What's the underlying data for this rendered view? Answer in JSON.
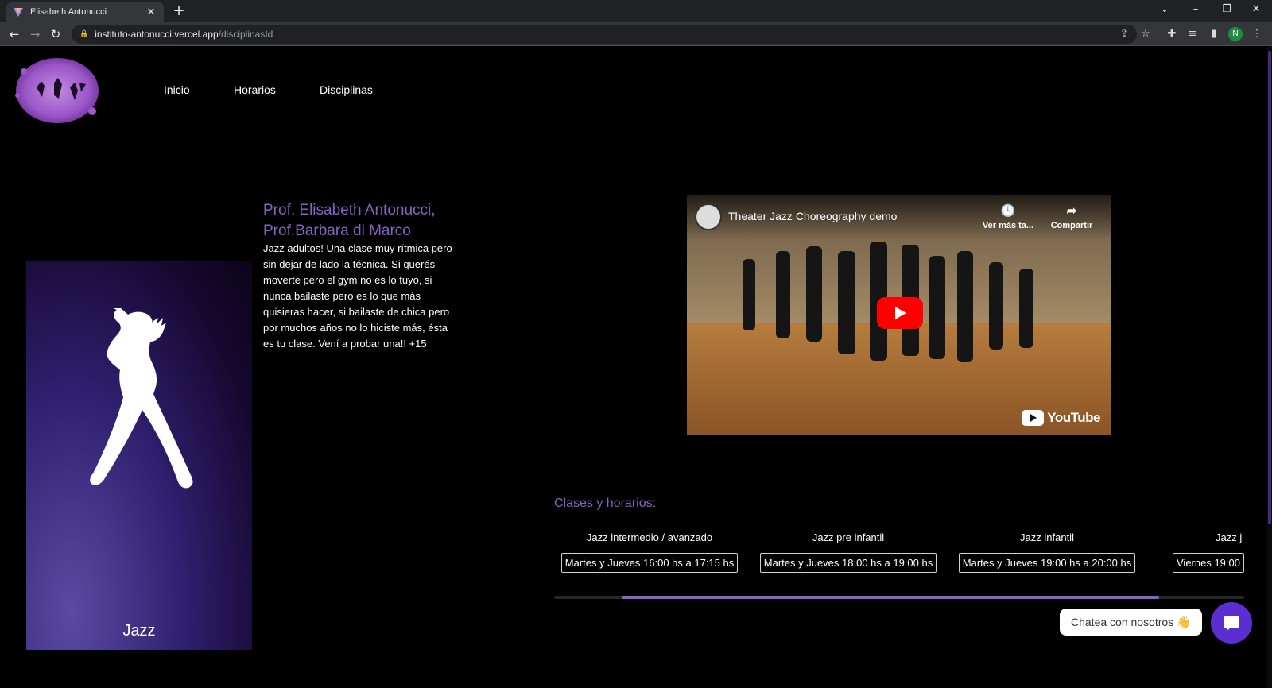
{
  "browser": {
    "tab_title": "Elisabeth Antonucci",
    "tab_close": "✕",
    "new_tab": "+",
    "url_host": "instituto-antonucci.vercel.app",
    "url_path": "/disciplinasId",
    "profile_initial": "N"
  },
  "nav": {
    "links": [
      "Inicio",
      "Horarios",
      "Disciplinas"
    ]
  },
  "discipline": {
    "card_label": "Jazz",
    "teachers": "Prof. Elisabeth Antonucci, Prof.Barbara di Marco",
    "description": "Jazz adultos! Una clase muy rítmica pero sin dejar de lado la técnica. Si querés moverte pero el gym no es lo tuyo, si nunca bailaste pero es lo que más quisieras hacer, si bailaste de chica pero por muchos años no lo hiciste más, ésta es tu clase. Vení a probar una!! +15"
  },
  "video": {
    "title": "Theater Jazz Choreography demo",
    "watch_later": "Ver más ta...",
    "share": "Compartir",
    "brand": "YouTube"
  },
  "schedule": {
    "heading": "Clases y horarios:",
    "classes": [
      {
        "name": "Jazz intermedio / avanzado",
        "time": "Martes y Jueves  16:00 hs a 17:15 hs"
      },
      {
        "name": "Jazz pre infantil",
        "time": "Martes y Jueves  18:00 hs a 19:00 hs"
      },
      {
        "name": "Jazz infantil",
        "time": "Martes y Jueves  19:00 hs a 20:00 hs"
      },
      {
        "name": "Jazz j",
        "time": "Viernes  19:00"
      }
    ]
  },
  "chat": {
    "label": "Chatea con nosotros 👋"
  },
  "icons": {
    "favicon": "triangle-logo-icon",
    "back": "arrow-left-icon",
    "forward": "arrow-right-icon",
    "reload": "reload-icon",
    "lock": "lock-icon",
    "share": "share-icon",
    "star": "star-icon",
    "extensions": "puzzle-icon",
    "playlist": "playlist-icon",
    "sidepanel": "sidepanel-icon",
    "menu": "kebab-menu-icon",
    "chat": "chat-icon"
  },
  "colors": {
    "accent": "#8a62c4",
    "chat_button": "#5b2ed1",
    "background": "#000000"
  }
}
